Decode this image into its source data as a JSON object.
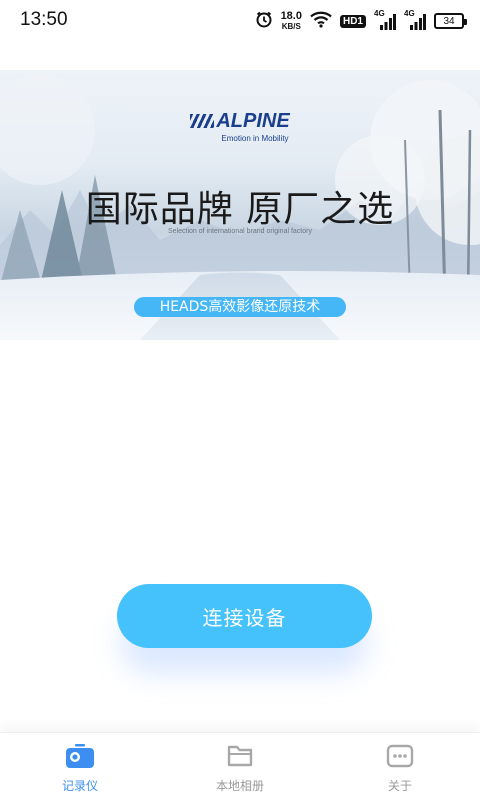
{
  "status_bar": {
    "time": "13:50",
    "net_speed_value": "18.0",
    "net_speed_unit": "KB/S",
    "hd_badge": "HD1",
    "signal1_tag": "4G",
    "signal2_tag": "4G",
    "battery": "34",
    "icons": [
      "alarm-icon",
      "wifi-icon",
      "hd-icon",
      "signal-icon",
      "signal-icon",
      "battery-icon"
    ]
  },
  "banner": {
    "brand_name": "ALPINE",
    "brand_tagline": "Emotion in Mobility",
    "headline": "国际品牌 原厂之选",
    "subline": "Selection of international brand original factory",
    "pill_text": "HEADS高效影像还原技术"
  },
  "main": {
    "connect_label": "连接设备"
  },
  "bottom_nav": {
    "items": [
      {
        "label": "记录仪",
        "icon": "camera-recorder-icon",
        "active": true
      },
      {
        "label": "本地相册",
        "icon": "folder-icon",
        "active": false
      },
      {
        "label": "关于",
        "icon": "message-icon",
        "active": false
      }
    ]
  },
  "colors": {
    "accent": "#45c1fb",
    "pill": "#45b6f6",
    "nav_active": "#3c8ff0",
    "nav_inactive": "#9a9a9a",
    "brand": "#1b3f8c"
  }
}
